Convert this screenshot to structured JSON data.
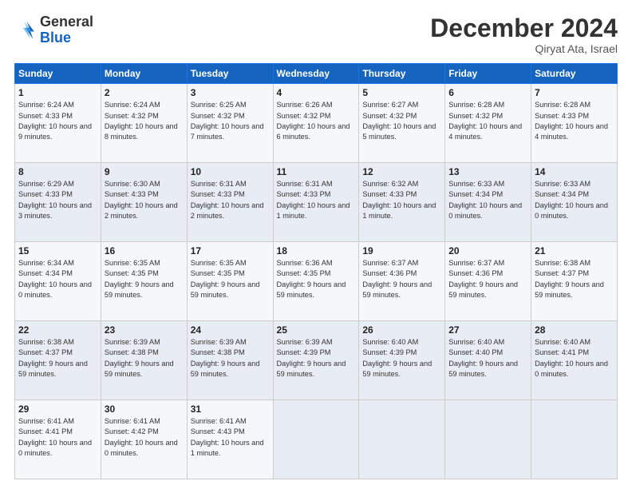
{
  "logo": {
    "general": "General",
    "blue": "Blue"
  },
  "title": "December 2024",
  "location": "Qiryat Ata, Israel",
  "days_of_week": [
    "Sunday",
    "Monday",
    "Tuesday",
    "Wednesday",
    "Thursday",
    "Friday",
    "Saturday"
  ],
  "weeks": [
    [
      {
        "day": 1,
        "sunrise": "6:24 AM",
        "sunset": "4:33 PM",
        "daylight": "10 hours and 9 minutes."
      },
      {
        "day": 2,
        "sunrise": "6:24 AM",
        "sunset": "4:32 PM",
        "daylight": "10 hours and 8 minutes."
      },
      {
        "day": 3,
        "sunrise": "6:25 AM",
        "sunset": "4:32 PM",
        "daylight": "10 hours and 7 minutes."
      },
      {
        "day": 4,
        "sunrise": "6:26 AM",
        "sunset": "4:32 PM",
        "daylight": "10 hours and 6 minutes."
      },
      {
        "day": 5,
        "sunrise": "6:27 AM",
        "sunset": "4:32 PM",
        "daylight": "10 hours and 5 minutes."
      },
      {
        "day": 6,
        "sunrise": "6:28 AM",
        "sunset": "4:32 PM",
        "daylight": "10 hours and 4 minutes."
      },
      {
        "day": 7,
        "sunrise": "6:28 AM",
        "sunset": "4:33 PM",
        "daylight": "10 hours and 4 minutes."
      }
    ],
    [
      {
        "day": 8,
        "sunrise": "6:29 AM",
        "sunset": "4:33 PM",
        "daylight": "10 hours and 3 minutes."
      },
      {
        "day": 9,
        "sunrise": "6:30 AM",
        "sunset": "4:33 PM",
        "daylight": "10 hours and 2 minutes."
      },
      {
        "day": 10,
        "sunrise": "6:31 AM",
        "sunset": "4:33 PM",
        "daylight": "10 hours and 2 minutes."
      },
      {
        "day": 11,
        "sunrise": "6:31 AM",
        "sunset": "4:33 PM",
        "daylight": "10 hours and 1 minute."
      },
      {
        "day": 12,
        "sunrise": "6:32 AM",
        "sunset": "4:33 PM",
        "daylight": "10 hours and 1 minute."
      },
      {
        "day": 13,
        "sunrise": "6:33 AM",
        "sunset": "4:34 PM",
        "daylight": "10 hours and 0 minutes."
      },
      {
        "day": 14,
        "sunrise": "6:33 AM",
        "sunset": "4:34 PM",
        "daylight": "10 hours and 0 minutes."
      }
    ],
    [
      {
        "day": 15,
        "sunrise": "6:34 AM",
        "sunset": "4:34 PM",
        "daylight": "10 hours and 0 minutes."
      },
      {
        "day": 16,
        "sunrise": "6:35 AM",
        "sunset": "4:35 PM",
        "daylight": "9 hours and 59 minutes."
      },
      {
        "day": 17,
        "sunrise": "6:35 AM",
        "sunset": "4:35 PM",
        "daylight": "9 hours and 59 minutes."
      },
      {
        "day": 18,
        "sunrise": "6:36 AM",
        "sunset": "4:35 PM",
        "daylight": "9 hours and 59 minutes."
      },
      {
        "day": 19,
        "sunrise": "6:37 AM",
        "sunset": "4:36 PM",
        "daylight": "9 hours and 59 minutes."
      },
      {
        "day": 20,
        "sunrise": "6:37 AM",
        "sunset": "4:36 PM",
        "daylight": "9 hours and 59 minutes."
      },
      {
        "day": 21,
        "sunrise": "6:38 AM",
        "sunset": "4:37 PM",
        "daylight": "9 hours and 59 minutes."
      }
    ],
    [
      {
        "day": 22,
        "sunrise": "6:38 AM",
        "sunset": "4:37 PM",
        "daylight": "9 hours and 59 minutes."
      },
      {
        "day": 23,
        "sunrise": "6:39 AM",
        "sunset": "4:38 PM",
        "daylight": "9 hours and 59 minutes."
      },
      {
        "day": 24,
        "sunrise": "6:39 AM",
        "sunset": "4:38 PM",
        "daylight": "9 hours and 59 minutes."
      },
      {
        "day": 25,
        "sunrise": "6:39 AM",
        "sunset": "4:39 PM",
        "daylight": "9 hours and 59 minutes."
      },
      {
        "day": 26,
        "sunrise": "6:40 AM",
        "sunset": "4:39 PM",
        "daylight": "9 hours and 59 minutes."
      },
      {
        "day": 27,
        "sunrise": "6:40 AM",
        "sunset": "4:40 PM",
        "daylight": "9 hours and 59 minutes."
      },
      {
        "day": 28,
        "sunrise": "6:40 AM",
        "sunset": "4:41 PM",
        "daylight": "10 hours and 0 minutes."
      }
    ],
    [
      {
        "day": 29,
        "sunrise": "6:41 AM",
        "sunset": "4:41 PM",
        "daylight": "10 hours and 0 minutes."
      },
      {
        "day": 30,
        "sunrise": "6:41 AM",
        "sunset": "4:42 PM",
        "daylight": "10 hours and 0 minutes."
      },
      {
        "day": 31,
        "sunrise": "6:41 AM",
        "sunset": "4:43 PM",
        "daylight": "10 hours and 1 minute."
      },
      null,
      null,
      null,
      null
    ]
  ]
}
